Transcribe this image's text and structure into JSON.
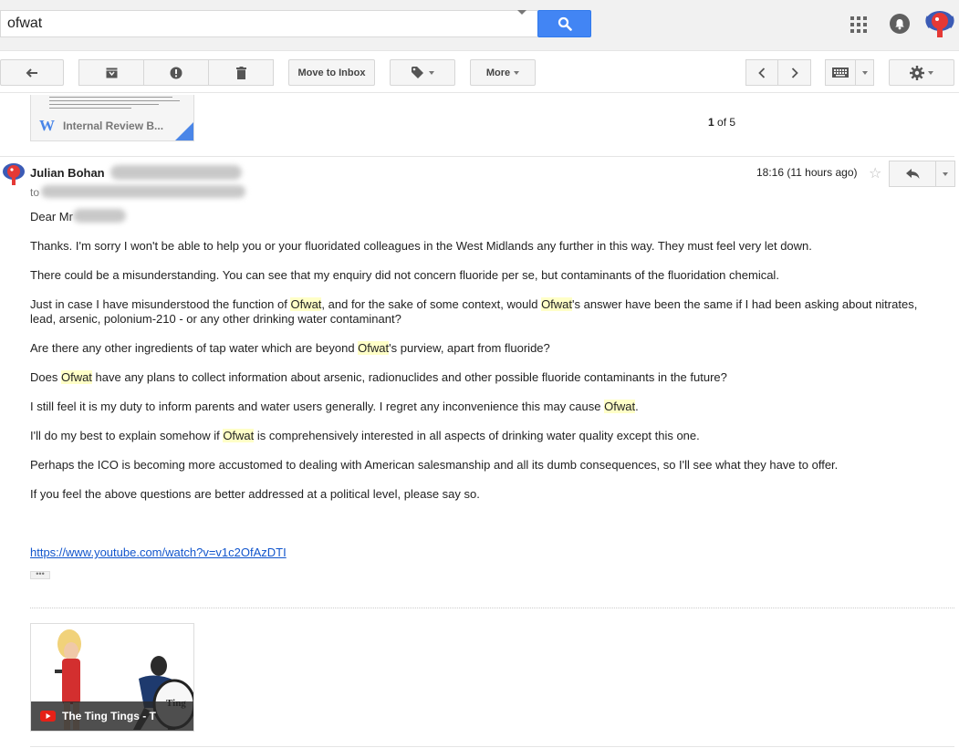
{
  "search": {
    "query": "ofwat"
  },
  "toolbar": {
    "move_to_inbox": "Move to Inbox",
    "more": "More",
    "pager_current": "1",
    "pager_of": "of",
    "pager_total": "5"
  },
  "attachment": {
    "name": "Internal Review B..."
  },
  "message": {
    "sender": "Julian Bohan",
    "to_label": "to",
    "time": "18:16 (11 hours ago)",
    "greeting": "Dear Mr",
    "highlight_term": "Ofwat",
    "paragraphs": [
      "Thanks. I'm sorry I won't be able to help you or your fluoridated colleagues in the West Midlands any further in this way. They must feel very let down.",
      "There could be a misunderstanding. You can see that my enquiry did not concern fluoride per se, but contaminants of the fluoridation chemical.",
      "Just in case I have misunderstood the function of Ofwat, and for the sake of some context, would Ofwat's answer have been the same if I had been asking about nitrates, lead, arsenic, polonium-210 - or any other drinking water contaminant?",
      "Are there any other ingredients of tap water which are beyond Ofwat's purview, apart from fluoride?",
      "Does Ofwat have any plans to collect information about arsenic, radionuclides and other possible fluoride contaminants in the future?",
      "I still feel it is my duty to inform parents and water users generally. I regret any inconvenience this may cause Ofwat.",
      "I'll do my best to explain somehow if Ofwat is comprehensively interested in all aspects of drinking water quality except this one.",
      "Perhaps the ICO is becoming more accustomed to dealing with American salesmanship and all its dumb consequences, so I'll see what they have to offer.",
      "If you feel the above questions are better addressed at a political level, please say so."
    ],
    "link": "https://www.youtube.com/watch?v=v1c2OfAzDTI",
    "ellipsis": "•••"
  },
  "video_card": {
    "title": "The Ting Tings - T"
  },
  "icons": {
    "search": "search-icon",
    "apps": "apps-grid-icon",
    "notifications": "bell-icon",
    "back": "back-arrow-icon",
    "archive": "archive-icon",
    "spam": "report-spam-icon",
    "delete": "trash-icon",
    "labels": "label-tag-icon",
    "prev": "chevron-left-icon",
    "next": "chevron-right-icon",
    "keyboard": "keyboard-icon",
    "settings": "gear-icon",
    "star": "star-icon",
    "reply": "reply-icon",
    "youtube": "youtube-icon"
  },
  "colors": {
    "accent": "#4285f4",
    "highlight": "#ffffc7",
    "link": "#1155cc"
  }
}
